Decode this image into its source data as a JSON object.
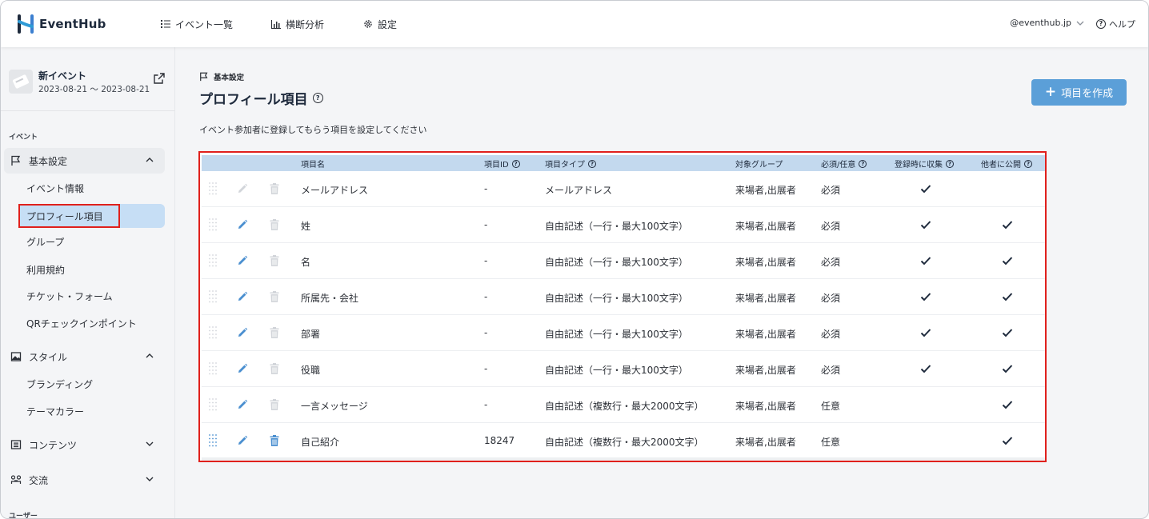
{
  "app": {
    "name": "EventHub"
  },
  "header": {
    "nav": [
      {
        "label": "イベント一覧",
        "icon": "list-icon"
      },
      {
        "label": "横断分析",
        "icon": "bar-chart-icon"
      },
      {
        "label": "設定",
        "icon": "gear-icon"
      }
    ],
    "account": "@eventhub.jp",
    "help": "ヘルプ"
  },
  "sidebar": {
    "event": {
      "name": "新イベント",
      "dates": "2023-08-21 〜 2023-08-21"
    },
    "section_event": "イベント",
    "section_user": "ユーザー",
    "groups": [
      {
        "label": "基本設定",
        "icon": "flag-icon",
        "expanded": true,
        "items": [
          "イベント情報",
          "プロフィール項目",
          "グループ",
          "利用規約",
          "チケット・フォーム",
          "QRチェックインポイント"
        ]
      },
      {
        "label": "スタイル",
        "icon": "image-icon",
        "expanded": true,
        "items": [
          "ブランディング",
          "テーマカラー"
        ]
      },
      {
        "label": "コンテンツ",
        "icon": "content-list-icon",
        "expanded": false,
        "items": []
      },
      {
        "label": "交流",
        "icon": "exchange-icon",
        "expanded": false,
        "items": []
      }
    ],
    "selected_item": "プロフィール項目"
  },
  "main": {
    "breadcrumb": "基本設定",
    "title": "プロフィール項目",
    "description": "イベント参加者に登録してもらう項目を設定してください",
    "create_button": "項目を作成",
    "table": {
      "headers": {
        "name": "項目名",
        "id": "項目ID",
        "type": "項目タイプ",
        "group": "対象グループ",
        "required": "必須/任意",
        "collect": "登録時に収集",
        "public": "他者に公開"
      },
      "rows": [
        {
          "name": "メールアドレス",
          "id": "-",
          "type": "メールアドレス",
          "group": "来場者,出展者",
          "required": "必須",
          "collect": true,
          "public": false,
          "editable": false,
          "deletable": false
        },
        {
          "name": "姓",
          "id": "-",
          "type": "自由記述（一行・最大100文字）",
          "group": "来場者,出展者",
          "required": "必須",
          "collect": true,
          "public": true,
          "editable": true,
          "deletable": false
        },
        {
          "name": "名",
          "id": "-",
          "type": "自由記述（一行・最大100文字）",
          "group": "来場者,出展者",
          "required": "必須",
          "collect": true,
          "public": true,
          "editable": true,
          "deletable": false
        },
        {
          "name": "所属先・会社",
          "id": "-",
          "type": "自由記述（一行・最大100文字）",
          "group": "来場者,出展者",
          "required": "必須",
          "collect": true,
          "public": true,
          "editable": true,
          "deletable": false
        },
        {
          "name": "部署",
          "id": "-",
          "type": "自由記述（一行・最大100文字）",
          "group": "来場者,出展者",
          "required": "必須",
          "collect": true,
          "public": true,
          "editable": true,
          "deletable": false
        },
        {
          "name": "役職",
          "id": "-",
          "type": "自由記述（一行・最大100文字）",
          "group": "来場者,出展者",
          "required": "必須",
          "collect": true,
          "public": true,
          "editable": true,
          "deletable": false
        },
        {
          "name": "一言メッセージ",
          "id": "-",
          "type": "自由記述（複数行・最大2000文字）",
          "group": "来場者,出展者",
          "required": "任意",
          "collect": false,
          "public": true,
          "editable": true,
          "deletable": false
        },
        {
          "name": "自己紹介",
          "id": "18247",
          "type": "自由記述（複数行・最大2000文字）",
          "group": "来場者,出展者",
          "required": "任意",
          "collect": false,
          "public": true,
          "editable": true,
          "deletable": true
        }
      ]
    }
  },
  "colors": {
    "accent": "#5b9fd8",
    "table_header": "#c3d9ee",
    "selected_item": "#c6def5",
    "highlight_border": "#e0201c",
    "icon_active": "#4a8fd0",
    "icon_disabled": "#d2d5da"
  }
}
